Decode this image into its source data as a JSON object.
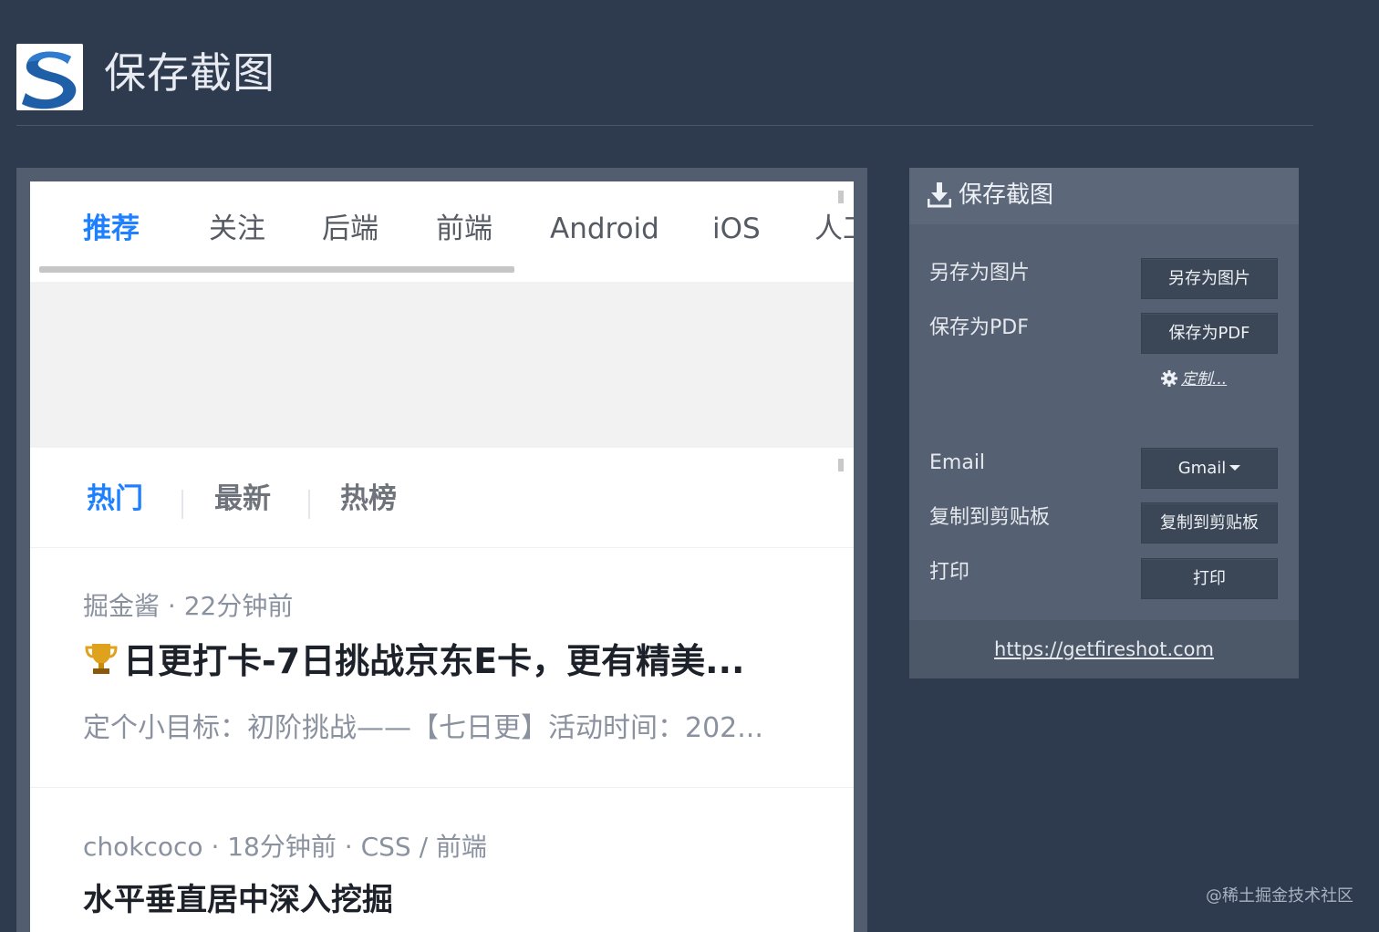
{
  "app": {
    "title": "保存截图"
  },
  "preview": {
    "tabs": [
      "推荐",
      "关注",
      "后端",
      "前端",
      "Android",
      "iOS",
      "人工"
    ],
    "sub_tabs": [
      "热门",
      "最新",
      "热榜"
    ],
    "articles": [
      {
        "meta": "掘金酱 · 22分钟前",
        "title": "日更打卡-7日挑战京东E卡，更有精美...",
        "excerpt": "定个小目标：初阶挑战——【七日更】活动时间：202..."
      },
      {
        "meta": "chokcoco · 18分钟前 · CSS / 前端",
        "title": "水平垂直居中深入挖掘"
      }
    ]
  },
  "panel": {
    "title": "保存截图",
    "rows": [
      {
        "label": "另存为图片",
        "button": "另存为图片"
      },
      {
        "label": "保存为PDF",
        "button": "保存为PDF"
      },
      {
        "label": "Email",
        "button": "Gmail"
      },
      {
        "label": "复制到剪贴板",
        "button": "复制到剪贴板"
      },
      {
        "label": "打印",
        "button": "打印"
      }
    ],
    "customize": "定制...",
    "footer_link": "https://getfireshot.com"
  },
  "watermark": "@稀土掘金技术社区",
  "colors": {
    "background": "#2e3a4e",
    "panel": "#556172",
    "button": "#3b4656",
    "accent": "#1e80ff"
  },
  "icons": [
    "fireshot-logo",
    "download-icon",
    "gear-icon",
    "trophy-icon",
    "caret-down-icon"
  ]
}
